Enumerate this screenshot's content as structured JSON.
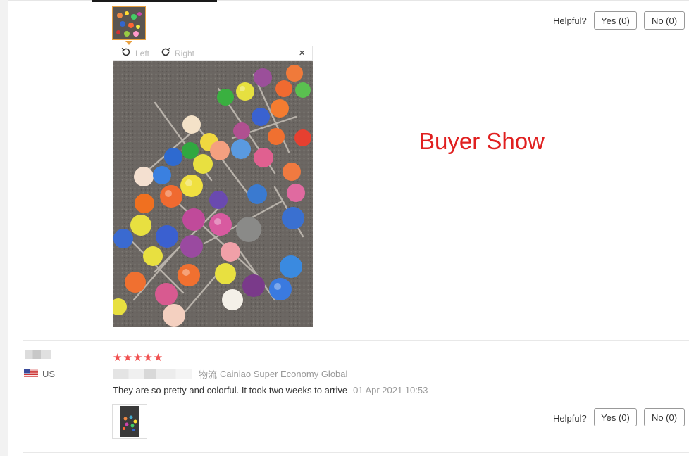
{
  "review_top": {
    "helpful_label": "Helpful?",
    "yes_label": "Yes (0)",
    "no_label": "No (0)"
  },
  "viewer": {
    "rotate_left_label": "Left",
    "rotate_right_label": "Right",
    "close_label": "×"
  },
  "overlay_text": "Buyer Show",
  "review_second": {
    "rating": 5,
    "stars": "★★★★★",
    "country": "US",
    "shipping_label": "物流",
    "shipping_method": "Cainiao Super Economy Global",
    "text": "They are so pretty and colorful. It took two weeks to arrive",
    "date": "01 Apr 2021 10:53",
    "helpful_label": "Helpful?",
    "yes_label": "Yes (0)",
    "no_label": "No (0)"
  },
  "colors": {
    "star": "#f05050",
    "overlay_text": "#e02020",
    "active_thumb_border": "#e8a040"
  },
  "icons": {
    "rotate_left": "rotate-left-icon",
    "rotate_right": "rotate-right-icon",
    "close": "close-icon",
    "flag": "us-flag-icon"
  }
}
